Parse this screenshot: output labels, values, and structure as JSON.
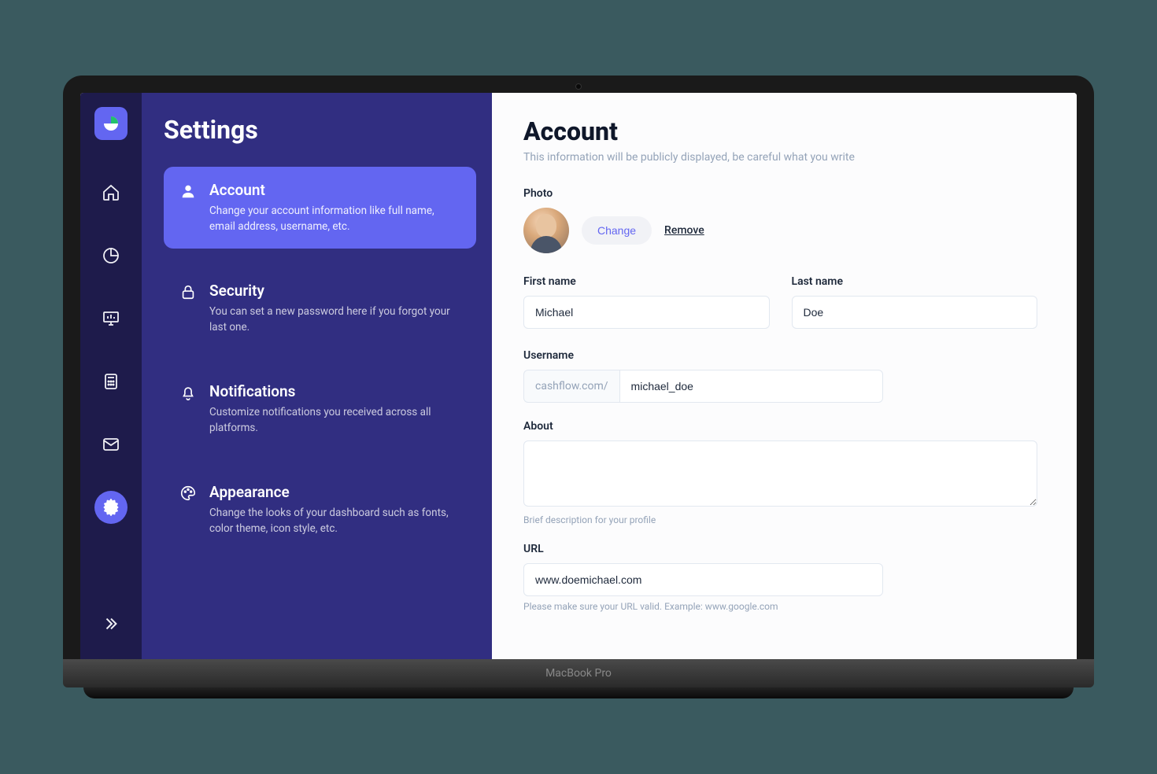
{
  "laptop_label": "MacBook Pro",
  "settings": {
    "title": "Settings",
    "items": [
      {
        "title": "Account",
        "desc": "Change your account information like full name, email address, username, etc."
      },
      {
        "title": "Security",
        "desc": "You can set a new password here if you forgot your last one."
      },
      {
        "title": "Notifications",
        "desc": "Customize notifications you received across all platforms."
      },
      {
        "title": "Appearance",
        "desc": "Change the looks of your dashboard such as fonts, color theme, icon style, etc."
      }
    ]
  },
  "main": {
    "title": "Account",
    "subtitle": "This information will be publicly displayed, be careful what you write",
    "photo": {
      "label": "Photo",
      "change": "Change",
      "remove": "Remove"
    },
    "first_name": {
      "label": "First name",
      "value": "Michael"
    },
    "last_name": {
      "label": "Last name",
      "value": "Doe"
    },
    "username": {
      "label": "Username",
      "prefix": "cashflow.com/",
      "value": "michael_doe"
    },
    "about": {
      "label": "About",
      "value": "",
      "hint": "Brief description for your profile"
    },
    "url": {
      "label": "URL",
      "value": "www.doemichael.com",
      "hint": "Please make sure your URL valid. Example: www.google.com"
    }
  },
  "colors": {
    "rail_bg": "#1e1b4b",
    "panel_bg": "#312e81",
    "accent": "#6366f1"
  }
}
